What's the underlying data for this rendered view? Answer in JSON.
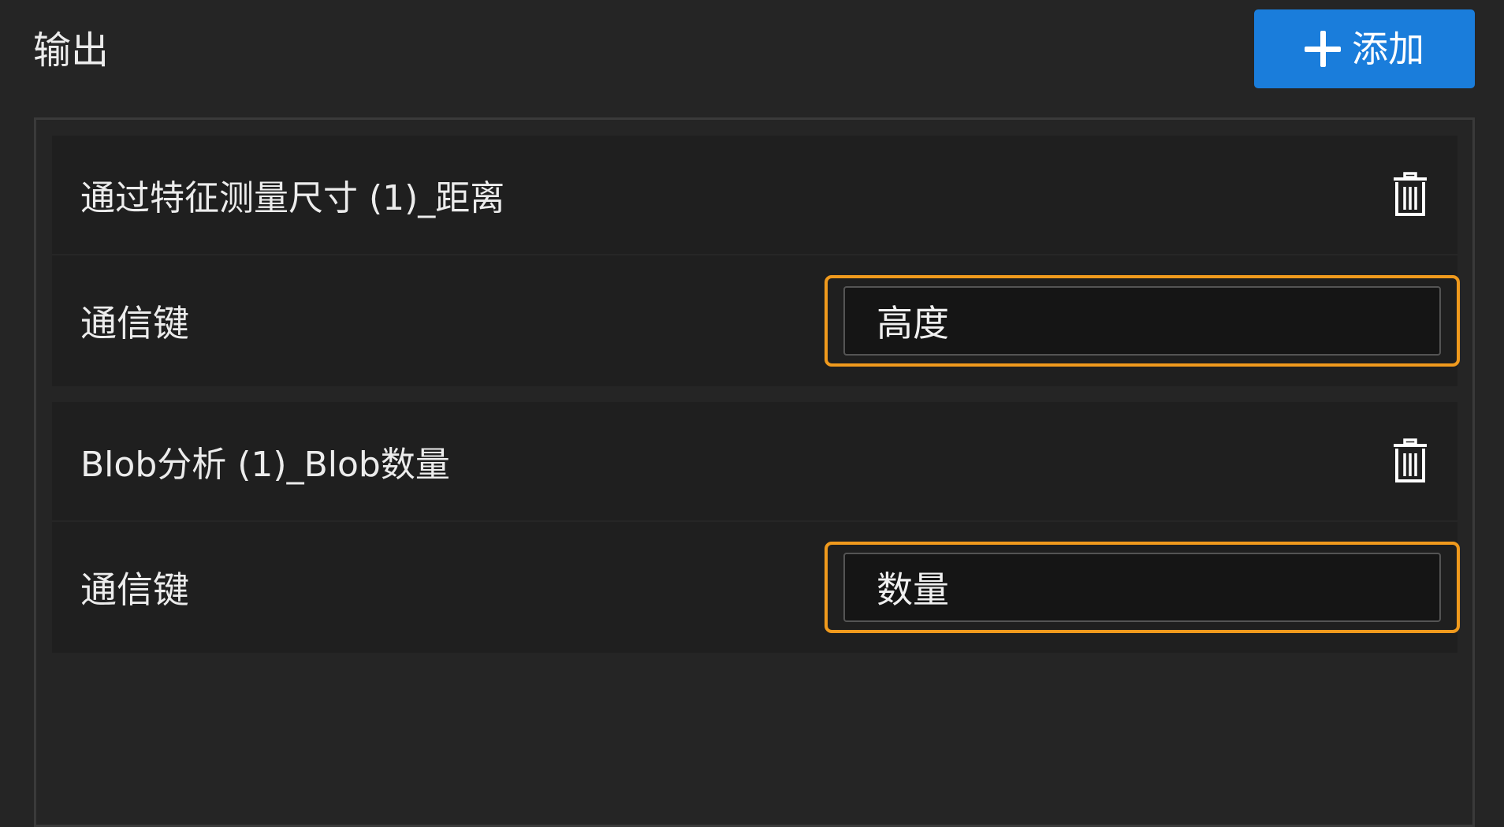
{
  "header": {
    "title": "输出",
    "add_button": {
      "label": "添加",
      "icon": "plus-icon"
    }
  },
  "outputs": [
    {
      "title": "通过特征测量尺寸 (1)_距离",
      "delete_icon": "trash-icon",
      "field_label": "通信键",
      "field_value": "高度"
    },
    {
      "title": "Blob分析 (1)_Blob数量",
      "delete_icon": "trash-icon",
      "field_label": "通信键",
      "field_value": "数量"
    }
  ],
  "colors": {
    "background": "#252525",
    "card": "#1f1f1f",
    "accent_button": "#1a7ddb",
    "highlight": "#f09a1d"
  }
}
